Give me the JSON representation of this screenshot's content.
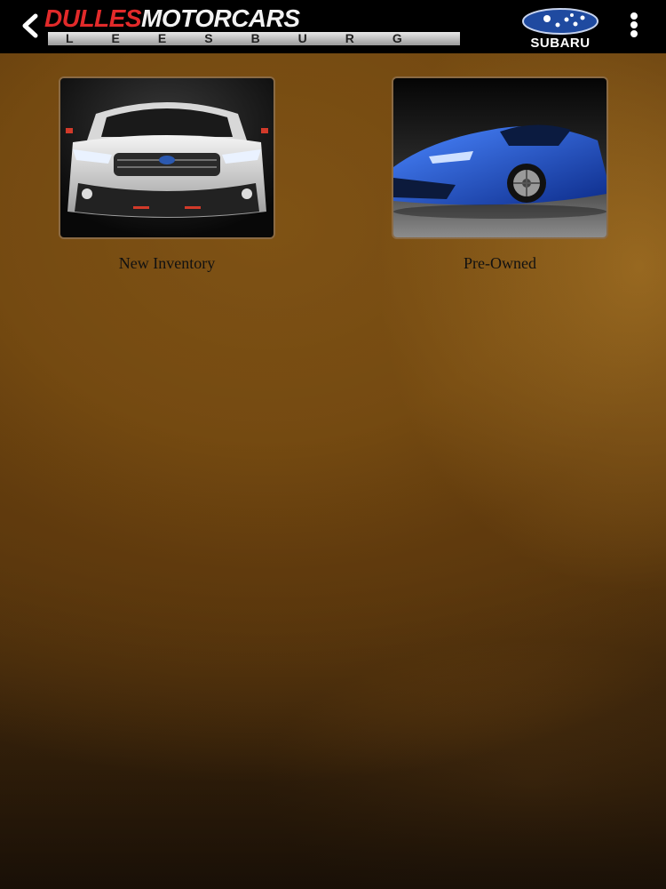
{
  "header": {
    "back_icon": "back-chevron-icon",
    "logo": {
      "dulles": "DULLES",
      "motorcars": "MOTORCARS",
      "leesburg": "LEESBURG"
    },
    "brand": "SUBARU",
    "menu_icon": "more-vertical-icon"
  },
  "tiles": [
    {
      "label": "New Inventory",
      "image": "white-subaru-suv-front"
    },
    {
      "label": "Pre-Owned",
      "image": "blue-subaru-coupe"
    }
  ],
  "colors": {
    "header_bg": "#000000",
    "accent_red": "#e22a2a",
    "background_amber": "#b8781e"
  }
}
